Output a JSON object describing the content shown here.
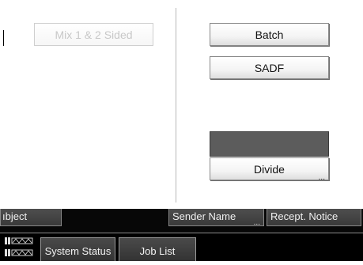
{
  "left_column": {
    "mix_button_label": "Mix 1 & 2 Sided"
  },
  "right_column": {
    "batch_label": "Batch",
    "sadf_label": "SADF",
    "divide_label": "Divide",
    "divide_ellipsis": "..."
  },
  "tabs": {
    "subject_label": "ıbject",
    "sender_name_label": "Sender Name",
    "sender_name_ellipsis": "...",
    "recept_notice_label": "Recept. Notice"
  },
  "status_bar": {
    "icon_name": "machine-status-icon",
    "system_status_label": "System Status",
    "job_list_label": "Job List"
  },
  "colors": {
    "accent_dark": "#5c5c5c",
    "bar_background": "#000000"
  }
}
